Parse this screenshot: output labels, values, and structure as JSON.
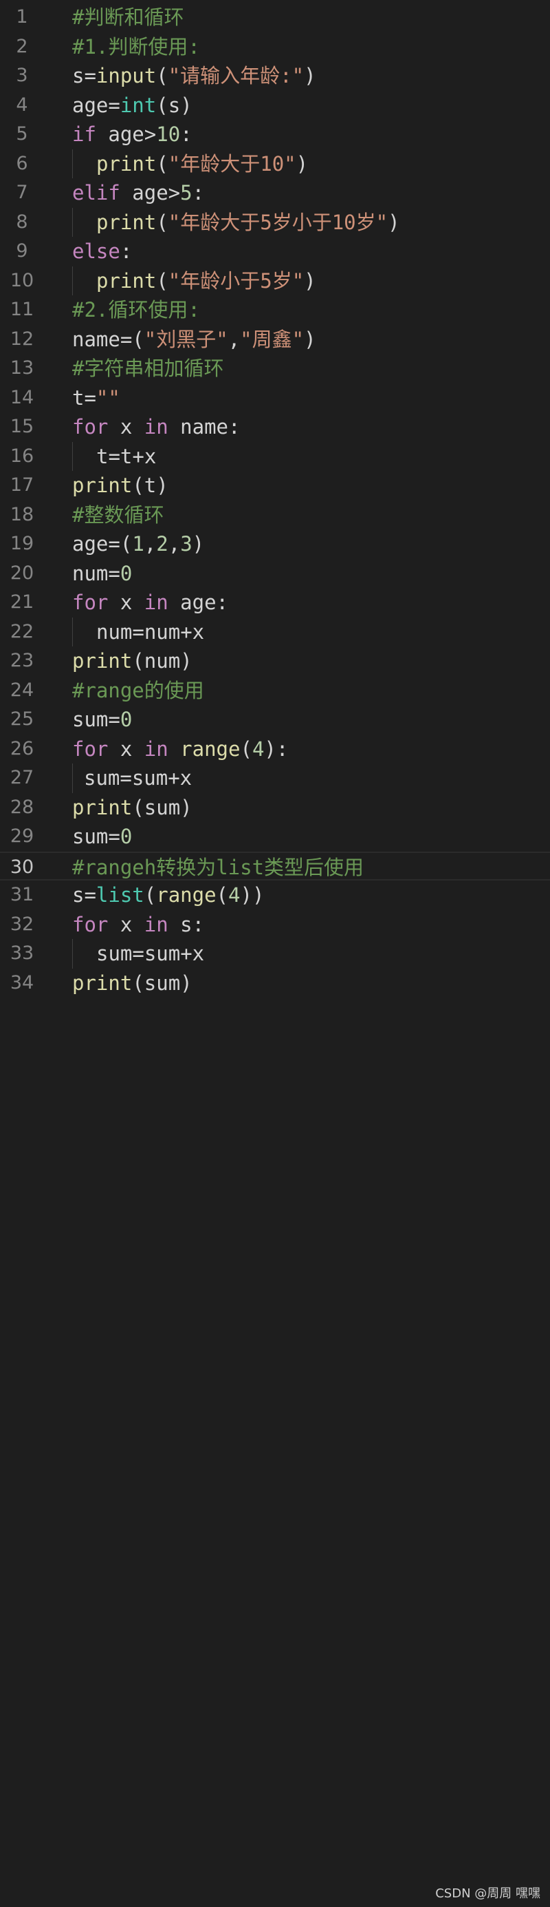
{
  "editor": {
    "lines": [
      {
        "n": "1",
        "indent": 0,
        "tokens": [
          {
            "t": "comment",
            "v": "#判断和循环"
          }
        ]
      },
      {
        "n": "2",
        "indent": 0,
        "tokens": [
          {
            "t": "comment",
            "v": "#1.判断使用:"
          }
        ]
      },
      {
        "n": "3",
        "indent": 0,
        "tokens": [
          {
            "t": "plain",
            "v": "s="
          },
          {
            "t": "func",
            "v": "input"
          },
          {
            "t": "plain",
            "v": "("
          },
          {
            "t": "string",
            "v": "\"请输入年龄:\""
          },
          {
            "t": "plain",
            "v": ")"
          }
        ]
      },
      {
        "n": "4",
        "indent": 0,
        "tokens": [
          {
            "t": "plain",
            "v": "age="
          },
          {
            "t": "builtin",
            "v": "int"
          },
          {
            "t": "plain",
            "v": "(s)"
          }
        ]
      },
      {
        "n": "5",
        "indent": 0,
        "tokens": [
          {
            "t": "keyword",
            "v": "if"
          },
          {
            "t": "plain",
            "v": " age>"
          },
          {
            "t": "number",
            "v": "10"
          },
          {
            "t": "plain",
            "v": ":"
          }
        ]
      },
      {
        "n": "6",
        "indent": 1,
        "tokens": [
          {
            "t": "func",
            "v": "print"
          },
          {
            "t": "plain",
            "v": "("
          },
          {
            "t": "string",
            "v": "\"年龄大于10\""
          },
          {
            "t": "plain",
            "v": ")"
          }
        ]
      },
      {
        "n": "7",
        "indent": 0,
        "tokens": [
          {
            "t": "keyword",
            "v": "elif"
          },
          {
            "t": "plain",
            "v": " age>"
          },
          {
            "t": "number",
            "v": "5"
          },
          {
            "t": "plain",
            "v": ":"
          }
        ]
      },
      {
        "n": "8",
        "indent": 1,
        "tokens": [
          {
            "t": "func",
            "v": "print"
          },
          {
            "t": "plain",
            "v": "("
          },
          {
            "t": "string",
            "v": "\"年龄大于5岁小于10岁\""
          },
          {
            "t": "plain",
            "v": ")"
          }
        ]
      },
      {
        "n": "9",
        "indent": 0,
        "tokens": [
          {
            "t": "keyword",
            "v": "else"
          },
          {
            "t": "plain",
            "v": ":"
          }
        ]
      },
      {
        "n": "10",
        "indent": 1,
        "tokens": [
          {
            "t": "func",
            "v": "print"
          },
          {
            "t": "plain",
            "v": "("
          },
          {
            "t": "string",
            "v": "\"年龄小于5岁\""
          },
          {
            "t": "plain",
            "v": ")"
          }
        ]
      },
      {
        "n": "11",
        "indent": 0,
        "tokens": [
          {
            "t": "comment",
            "v": "#2.循环使用:"
          }
        ]
      },
      {
        "n": "12",
        "indent": 0,
        "tokens": [
          {
            "t": "plain",
            "v": "name=("
          },
          {
            "t": "string",
            "v": "\"刘黑子\""
          },
          {
            "t": "plain",
            "v": ","
          },
          {
            "t": "string",
            "v": "\"周鑫\""
          },
          {
            "t": "plain",
            "v": ")"
          }
        ]
      },
      {
        "n": "13",
        "indent": 0,
        "tokens": [
          {
            "t": "comment",
            "v": "#字符串相加循环"
          }
        ]
      },
      {
        "n": "14",
        "indent": 0,
        "tokens": [
          {
            "t": "plain",
            "v": "t="
          },
          {
            "t": "string",
            "v": "\"\""
          }
        ]
      },
      {
        "n": "15",
        "indent": 0,
        "tokens": [
          {
            "t": "keyword",
            "v": "for"
          },
          {
            "t": "plain",
            "v": " x "
          },
          {
            "t": "keyword",
            "v": "in"
          },
          {
            "t": "plain",
            "v": " name:"
          }
        ]
      },
      {
        "n": "16",
        "indent": 1,
        "tokens": [
          {
            "t": "plain",
            "v": "t=t+x"
          }
        ]
      },
      {
        "n": "17",
        "indent": 0,
        "tokens": [
          {
            "t": "func",
            "v": "print"
          },
          {
            "t": "plain",
            "v": "(t)"
          }
        ]
      },
      {
        "n": "18",
        "indent": 0,
        "tokens": [
          {
            "t": "comment",
            "v": "#整数循环"
          }
        ]
      },
      {
        "n": "19",
        "indent": 0,
        "tokens": [
          {
            "t": "plain",
            "v": "age=("
          },
          {
            "t": "number",
            "v": "1"
          },
          {
            "t": "plain",
            "v": ","
          },
          {
            "t": "number",
            "v": "2"
          },
          {
            "t": "plain",
            "v": ","
          },
          {
            "t": "number",
            "v": "3"
          },
          {
            "t": "plain",
            "v": ")"
          }
        ]
      },
      {
        "n": "20",
        "indent": 0,
        "tokens": [
          {
            "t": "plain",
            "v": "num="
          },
          {
            "t": "number",
            "v": "0"
          }
        ]
      },
      {
        "n": "21",
        "indent": 0,
        "tokens": [
          {
            "t": "keyword",
            "v": "for"
          },
          {
            "t": "plain",
            "v": " x "
          },
          {
            "t": "keyword",
            "v": "in"
          },
          {
            "t": "plain",
            "v": " age:"
          }
        ]
      },
      {
        "n": "22",
        "indent": 1,
        "tokens": [
          {
            "t": "plain",
            "v": "num=num+x"
          }
        ]
      },
      {
        "n": "23",
        "indent": 0,
        "tokens": [
          {
            "t": "func",
            "v": "print"
          },
          {
            "t": "plain",
            "v": "(num)"
          }
        ]
      },
      {
        "n": "24",
        "indent": 0,
        "tokens": [
          {
            "t": "comment",
            "v": "#range的使用"
          }
        ]
      },
      {
        "n": "25",
        "indent": 0,
        "tokens": [
          {
            "t": "plain",
            "v": "sum="
          },
          {
            "t": "number",
            "v": "0"
          }
        ]
      },
      {
        "n": "26",
        "indent": 0,
        "tokens": [
          {
            "t": "keyword",
            "v": "for"
          },
          {
            "t": "plain",
            "v": " x "
          },
          {
            "t": "keyword",
            "v": "in"
          },
          {
            "t": "plain",
            "v": " "
          },
          {
            "t": "func",
            "v": "range"
          },
          {
            "t": "plain",
            "v": "("
          },
          {
            "t": "number",
            "v": "4"
          },
          {
            "t": "plain",
            "v": "):"
          }
        ]
      },
      {
        "n": "27",
        "indent": 2,
        "tokens": [
          {
            "t": "plain",
            "v": "sum=sum+x"
          }
        ]
      },
      {
        "n": "28",
        "indent": 0,
        "tokens": [
          {
            "t": "func",
            "v": "print"
          },
          {
            "t": "plain",
            "v": "(sum)"
          }
        ]
      },
      {
        "n": "29",
        "indent": 0,
        "tokens": [
          {
            "t": "plain",
            "v": "sum="
          },
          {
            "t": "number",
            "v": "0"
          }
        ]
      },
      {
        "n": "30",
        "indent": 0,
        "current": true,
        "tokens": [
          {
            "t": "comment",
            "v": "#rangeh转换为list类型后使用"
          }
        ]
      },
      {
        "n": "31",
        "indent": 0,
        "tokens": [
          {
            "t": "plain",
            "v": "s="
          },
          {
            "t": "builtin",
            "v": "list"
          },
          {
            "t": "plain",
            "v": "("
          },
          {
            "t": "func",
            "v": "range"
          },
          {
            "t": "plain",
            "v": "("
          },
          {
            "t": "number",
            "v": "4"
          },
          {
            "t": "plain",
            "v": "))"
          }
        ]
      },
      {
        "n": "32",
        "indent": 0,
        "tokens": [
          {
            "t": "keyword",
            "v": "for"
          },
          {
            "t": "plain",
            "v": " x "
          },
          {
            "t": "keyword",
            "v": "in"
          },
          {
            "t": "plain",
            "v": " s:"
          }
        ]
      },
      {
        "n": "33",
        "indent": 1,
        "tokens": [
          {
            "t": "plain",
            "v": "sum=sum+x"
          }
        ]
      },
      {
        "n": "34",
        "indent": 0,
        "tokens": [
          {
            "t": "func",
            "v": "print"
          },
          {
            "t": "plain",
            "v": "(sum)"
          }
        ]
      }
    ]
  },
  "watermark": "CSDN @周周  嘿嘿",
  "colors": {
    "background": "#1e1e1e",
    "comment": "#6a9955",
    "keyword": "#c586c0",
    "function": "#dcdcaa",
    "builtin": "#4ec9b0",
    "string": "#ce9178",
    "number": "#b5cea8",
    "text": "#d4d4d4",
    "line_number": "#858585"
  }
}
